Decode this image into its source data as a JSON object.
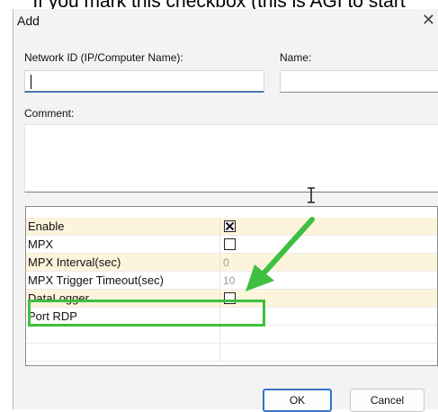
{
  "caption": "If you mark this checkbox (this is AGI to start",
  "dialog": {
    "title": "Add",
    "close_glyph": "✕",
    "network_id_label": "Network ID (IP/Computer Name):",
    "network_id_value": "",
    "name_label": "Name:",
    "name_value": "",
    "comment_label": "Comment:",
    "comment_value": ""
  },
  "grid": {
    "rows": [
      {
        "name": "Enable",
        "type": "checkbox",
        "checked": true,
        "value": ""
      },
      {
        "name": "MPX",
        "type": "checkbox",
        "checked": false,
        "value": ""
      },
      {
        "name": "MPX Interval(sec)",
        "type": "text",
        "value": "0"
      },
      {
        "name": "MPX Trigger Timeout(sec)",
        "type": "text",
        "value": "10"
      },
      {
        "name": "DataLogger",
        "type": "checkbox",
        "checked": false,
        "value": ""
      },
      {
        "name": "Port RDP",
        "type": "text",
        "value": ""
      },
      {
        "name": "",
        "type": "text",
        "value": ""
      },
      {
        "name": "",
        "type": "text",
        "value": ""
      }
    ]
  },
  "buttons": {
    "ok": "OK",
    "cancel": "Cancel"
  },
  "colors": {
    "highlight": "#3fbf3f",
    "row_highlight": "#fdf4dc",
    "accent": "#3674c6"
  }
}
